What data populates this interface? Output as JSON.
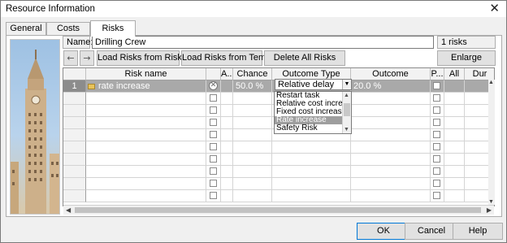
{
  "window": {
    "title": "Resource Information",
    "close_glyph": "✕"
  },
  "tabs": [
    {
      "label": "General"
    },
    {
      "label": "Costs"
    },
    {
      "label": "Risks"
    }
  ],
  "form": {
    "name_label": "Name:",
    "name_value": "Drilling Crew",
    "risk_count": "1 risks"
  },
  "toolbar": {
    "back_glyph": "←",
    "forward_glyph": "→",
    "load_view": "Load Risks from Risk View",
    "load_template": "Load Risks from Template",
    "delete_all": "Delete All Risks",
    "enlarge": "Enlarge"
  },
  "grid": {
    "columns": [
      "",
      "Risk name",
      "",
      "A...",
      "Chance",
      "Outcome Type",
      "Outcome",
      "P...",
      "All",
      "Dur"
    ],
    "rows": [
      {
        "num": "1",
        "name": "rate increase",
        "chance": "50.0 %",
        "outcome_type": "Relative delay",
        "outcome": "20.0 %"
      }
    ],
    "empty_rows": 9
  },
  "dropdown": {
    "options": [
      "Restart task",
      "Relative cost increase",
      "Fixed cost increase",
      "Rate increase",
      "Safety Risk"
    ],
    "highlighted": "Rate increase"
  },
  "footer": {
    "ok": "OK",
    "cancel": "Cancel",
    "help": "Help"
  },
  "colors": {
    "selected_row": "#a9a9a9",
    "accent": "#0078d7"
  }
}
